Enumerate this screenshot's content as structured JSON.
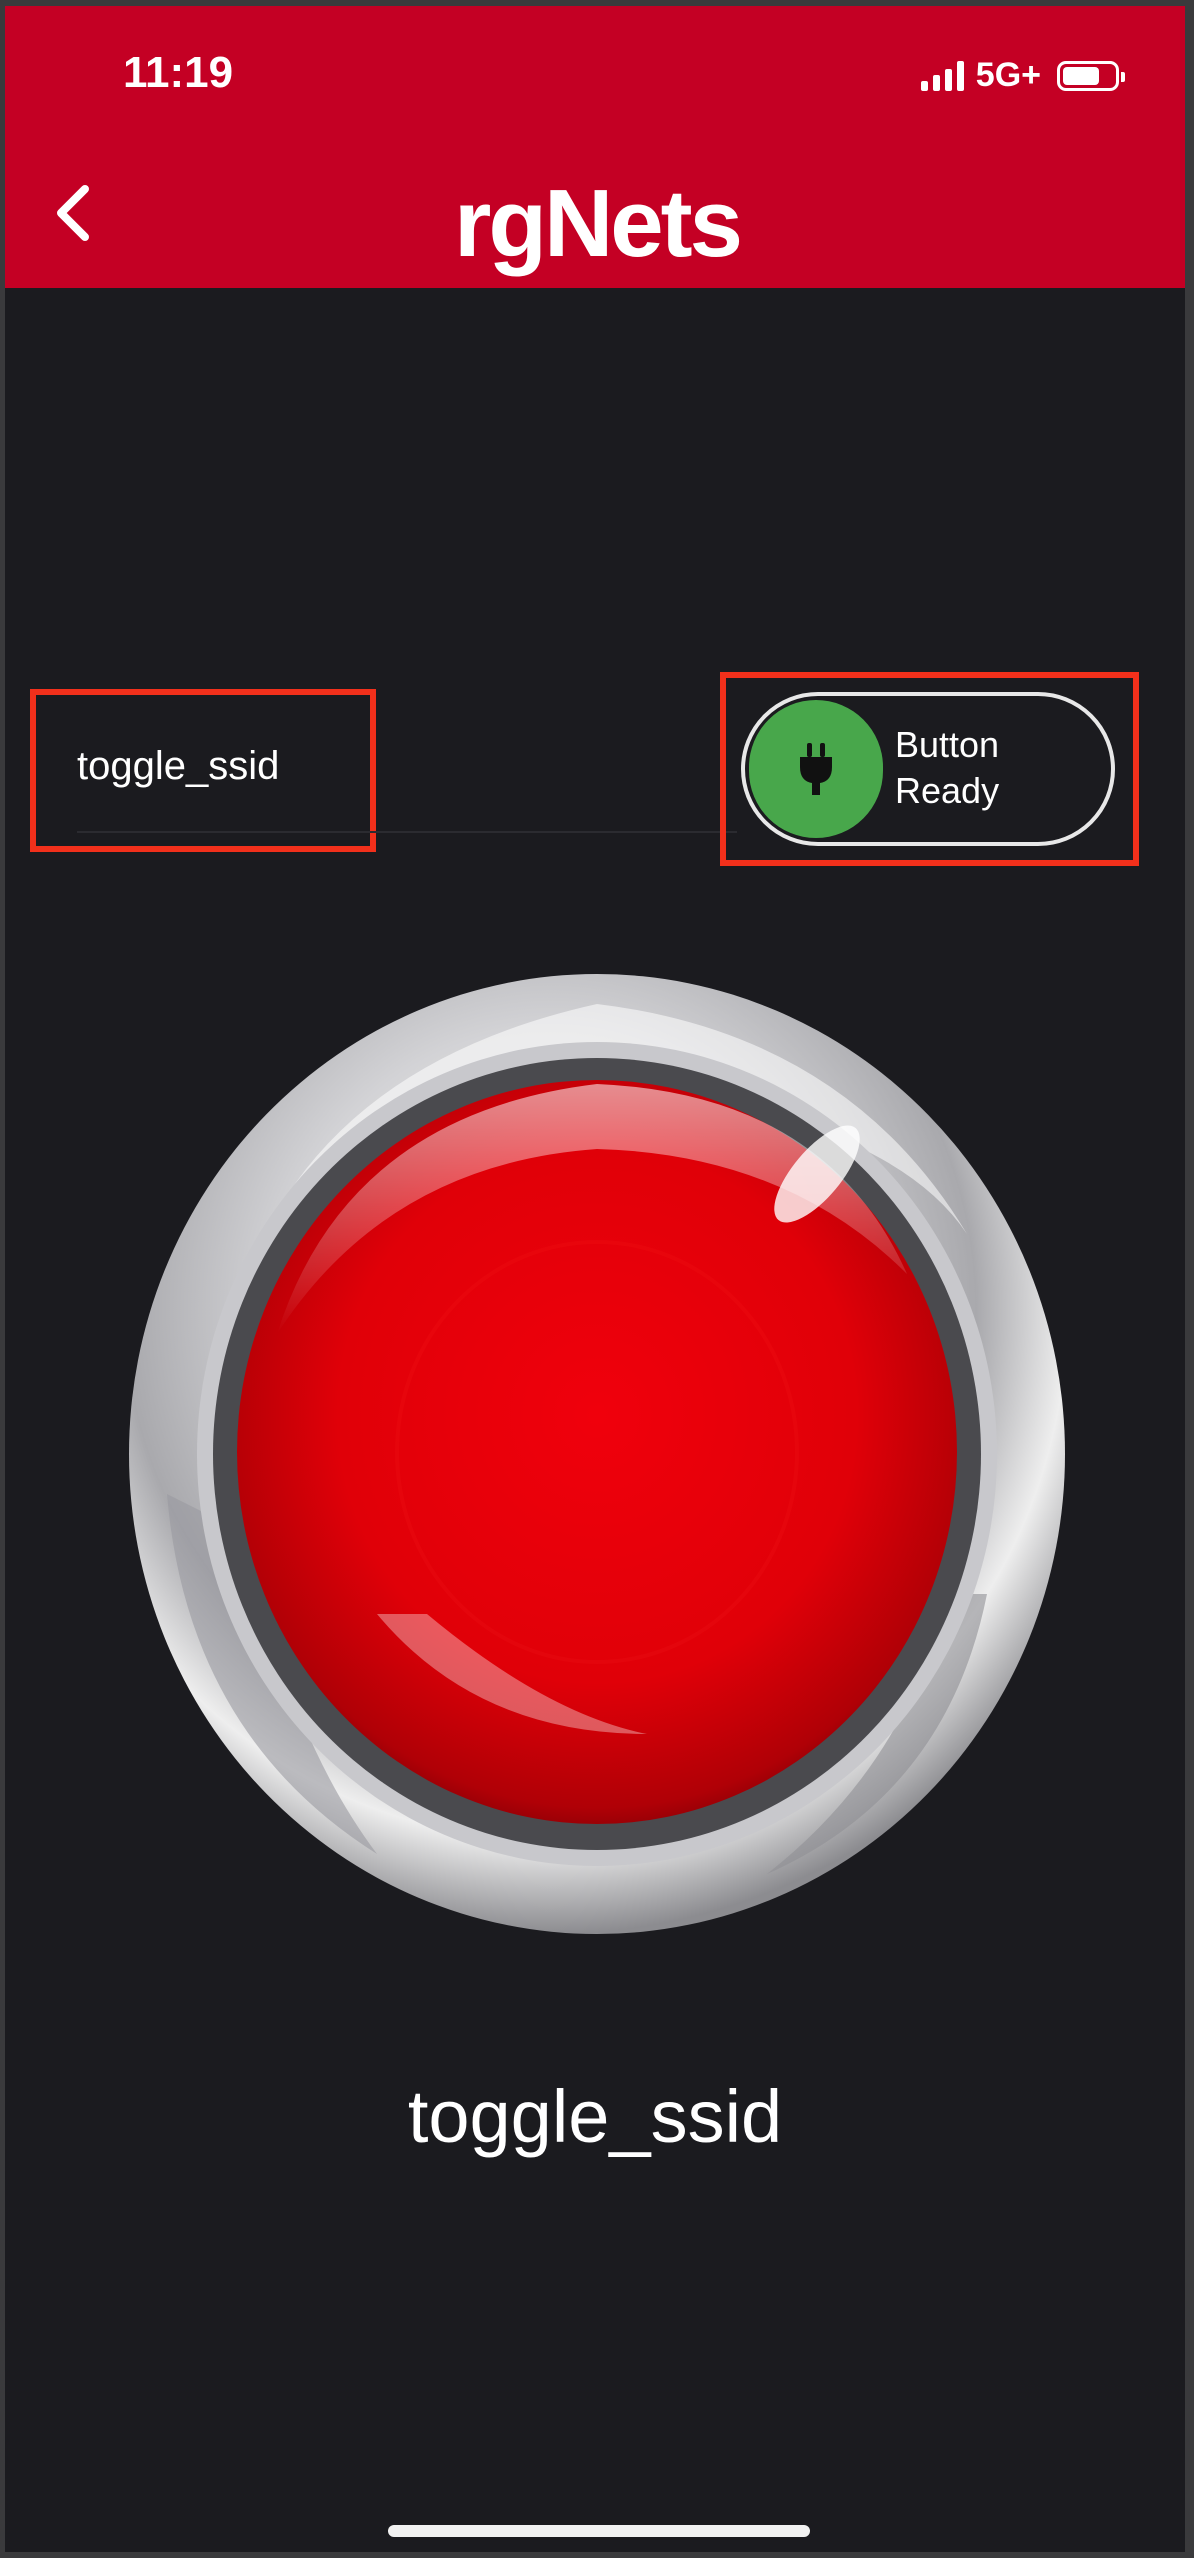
{
  "status_bar": {
    "time": "11:19",
    "network": "5G+",
    "signal_icon": "signal-icon",
    "battery_level": 0.72
  },
  "header": {
    "back_icon": "chevron-left-icon",
    "logo_text": "rgNets",
    "color": "#c40024"
  },
  "content": {
    "title_label": "toggle_ssid",
    "status_pill": {
      "icon": "plug-icon",
      "line1": "Button",
      "line2": "Ready",
      "dot_color": "#48a74b"
    },
    "big_button": {
      "icon": "red-push-button",
      "label": "toggle_ssid"
    }
  },
  "colors": {
    "background": "#1b1b1f",
    "highlight": "#f2301b"
  }
}
